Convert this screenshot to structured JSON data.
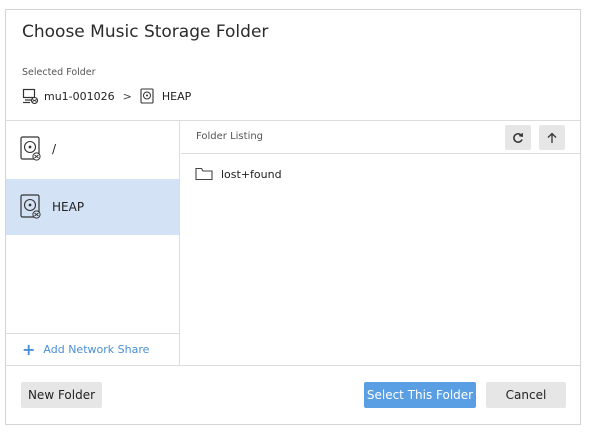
{
  "dialog": {
    "title": "Choose Music Storage Folder",
    "selected_folder_label": "Selected Folder",
    "breadcrumb": {
      "host": "mu1-001026",
      "separator": ">",
      "folder": "HEAP"
    }
  },
  "sidebar": {
    "items": [
      {
        "label": "/",
        "icon": "hard-drive-icon",
        "active": false
      },
      {
        "label": "HEAP",
        "icon": "hard-drive-icon",
        "active": true
      }
    ],
    "add_share_label": "Add Network Share"
  },
  "listing": {
    "title": "Folder Listing",
    "entries": [
      {
        "name": "lost+found",
        "icon": "folder-icon"
      }
    ]
  },
  "footer": {
    "new_folder_label": "New Folder",
    "select_label": "Select This Folder",
    "cancel_label": "Cancel"
  },
  "colors": {
    "accent": "#5a9ee4",
    "active_row": "#d3e3f5",
    "link": "#4a8fd6"
  }
}
